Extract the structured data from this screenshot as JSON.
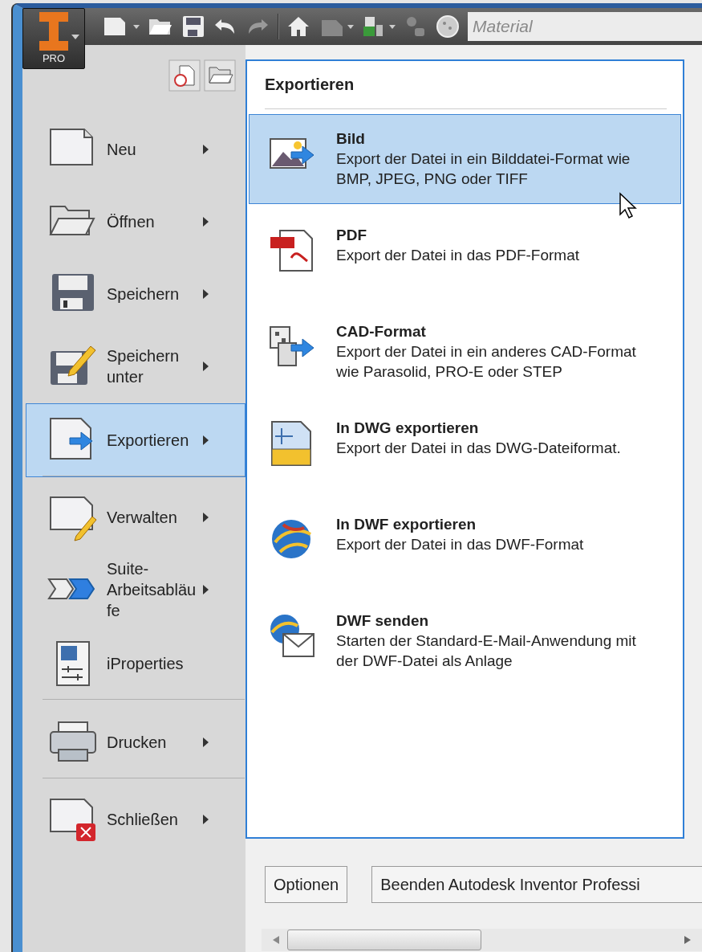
{
  "app_button": {
    "label": "PRO"
  },
  "toolbar": {
    "material_combo": {
      "value": "Material"
    }
  },
  "menu": {
    "items": [
      {
        "label": "Neu",
        "has_submenu": true,
        "selected": false,
        "separator_after": false
      },
      {
        "label": "Öffnen",
        "has_submenu": true,
        "selected": false,
        "separator_after": false
      },
      {
        "label": "Speichern",
        "has_submenu": true,
        "selected": false,
        "separator_after": false
      },
      {
        "label": "Speichern unter",
        "has_submenu": true,
        "selected": false,
        "separator_after": false
      },
      {
        "label": "Exportieren",
        "has_submenu": true,
        "selected": true,
        "separator_after": true
      },
      {
        "label": "Verwalten",
        "has_submenu": true,
        "selected": false,
        "separator_after": false
      },
      {
        "label": "Suite-Arbeitsabläufe",
        "has_submenu": true,
        "selected": false,
        "separator_after": false
      },
      {
        "label": "iProperties",
        "has_submenu": false,
        "selected": false,
        "separator_after": true
      },
      {
        "label": "Drucken",
        "has_submenu": true,
        "selected": false,
        "separator_after": true
      },
      {
        "label": "Schließen",
        "has_submenu": true,
        "selected": false,
        "separator_after": false
      }
    ]
  },
  "submenu": {
    "title": "Exportieren",
    "items": [
      {
        "title": "Bild",
        "description": "Export der Datei in ein Bilddatei-Format wie BMP, JPEG, PNG oder TIFF",
        "selected": true
      },
      {
        "title": "PDF",
        "description": "Export der Datei in das PDF-Format",
        "selected": false
      },
      {
        "title": "CAD-Format",
        "description": "Export der Datei in ein anderes CAD-Format wie Parasolid, PRO-E oder STEP",
        "selected": false
      },
      {
        "title": "In DWG exportieren",
        "description": "Export der Datei in das DWG-Dateiformat.",
        "selected": false
      },
      {
        "title": "In DWF exportieren",
        "description": "Export der Datei in das DWF-Format",
        "selected": false
      },
      {
        "title": "DWF senden",
        "description": "Starten der Standard-E-Mail-Anwendung mit der DWF-Datei als Anlage",
        "selected": false
      }
    ]
  },
  "footer": {
    "buttons": [
      "Optionen",
      "Beenden Autodesk Inventor Professi"
    ]
  }
}
